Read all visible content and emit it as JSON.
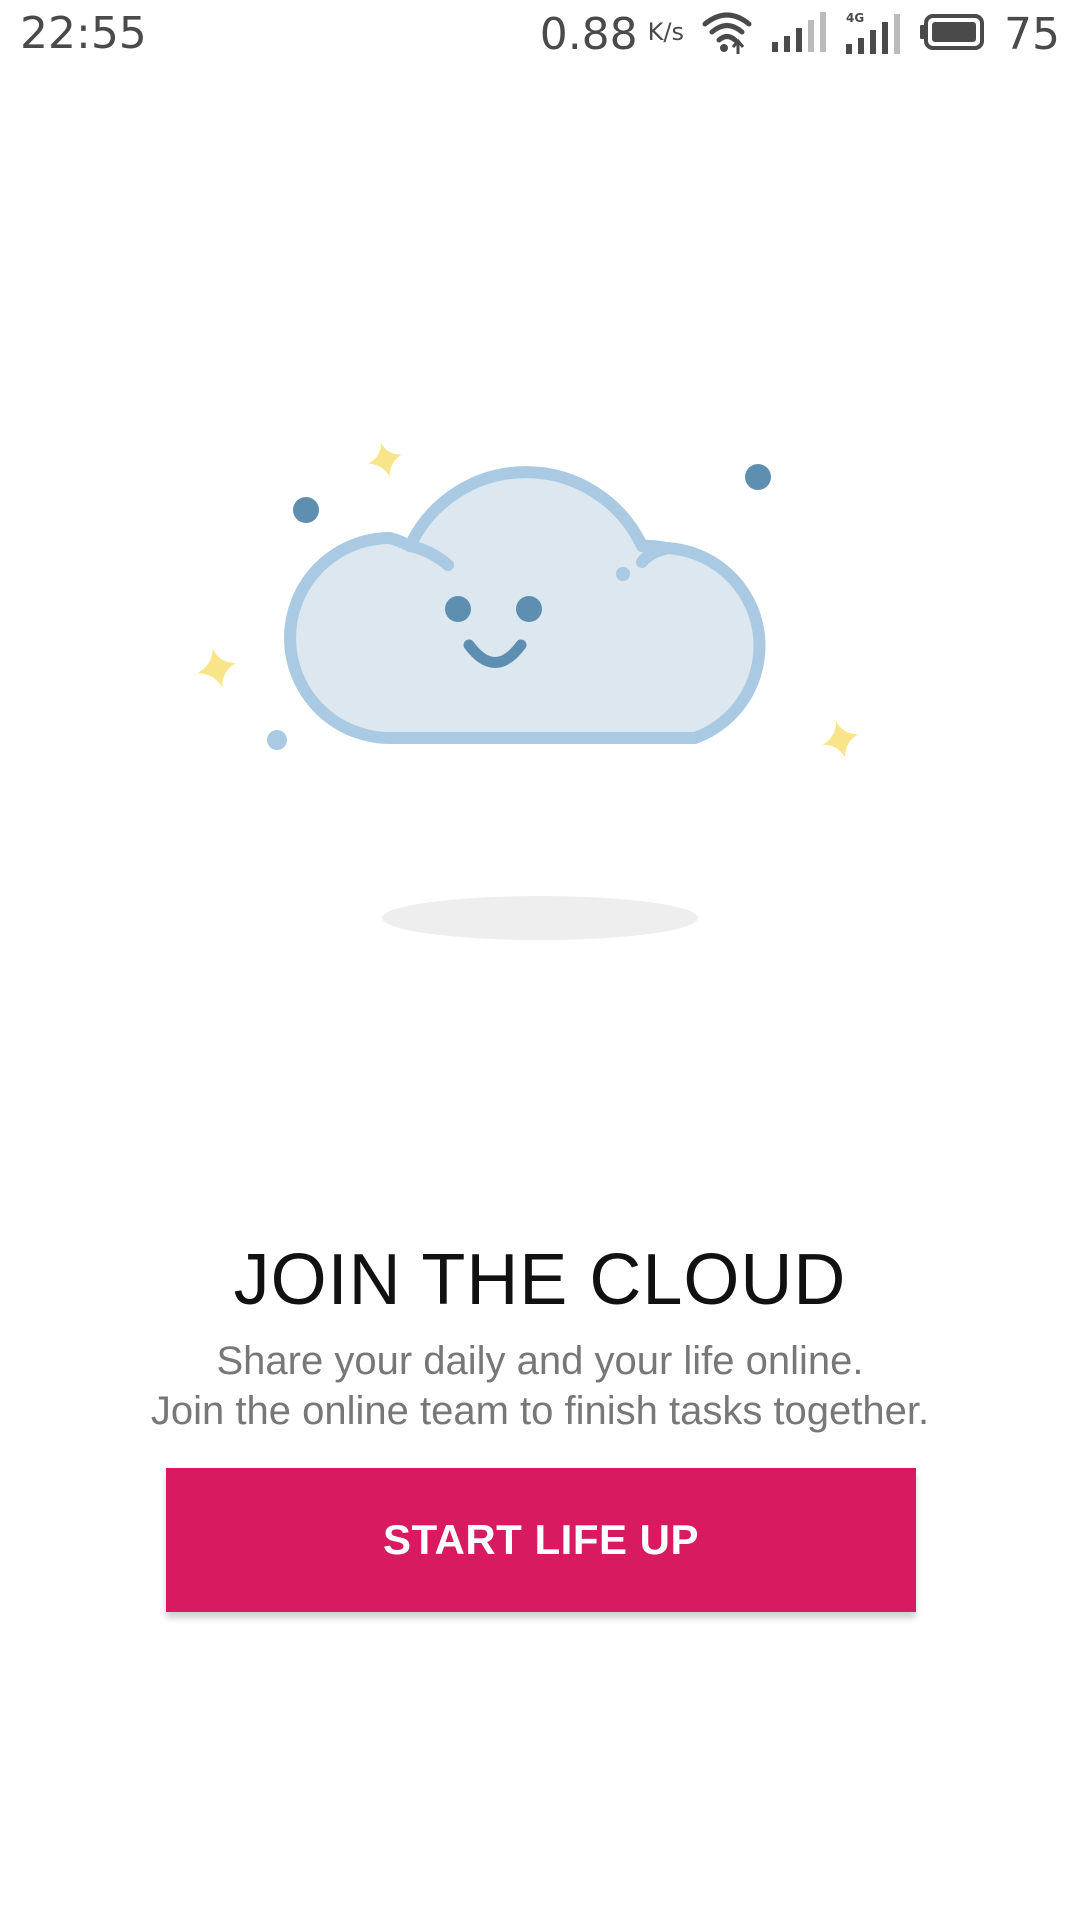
{
  "status_bar": {
    "time": "22:55",
    "network_speed": "0.88",
    "network_speed_unit": "K/s",
    "battery_level": "75",
    "icons": [
      "wifi-icon",
      "signal-icon",
      "signal-4g-icon",
      "battery-icon"
    ]
  },
  "illustration": {
    "name": "smiling-cloud",
    "colors": {
      "cloud_fill": "#dce7ef",
      "cloud_stroke": "#a9cae2",
      "face": "#5e8fb0",
      "sparkle": "#f8e58a",
      "dot_dark": "#5e8fb0",
      "dot_light": "#a9cae2",
      "shadow": "#eeeeee"
    }
  },
  "content": {
    "title": "JOIN THE CLOUD",
    "subtitle_line1": "Share your daily and your life online.",
    "subtitle_line2": "Join the online team to finish tasks together."
  },
  "cta": {
    "label": "START LIFE UP",
    "color": "#d81b60"
  }
}
